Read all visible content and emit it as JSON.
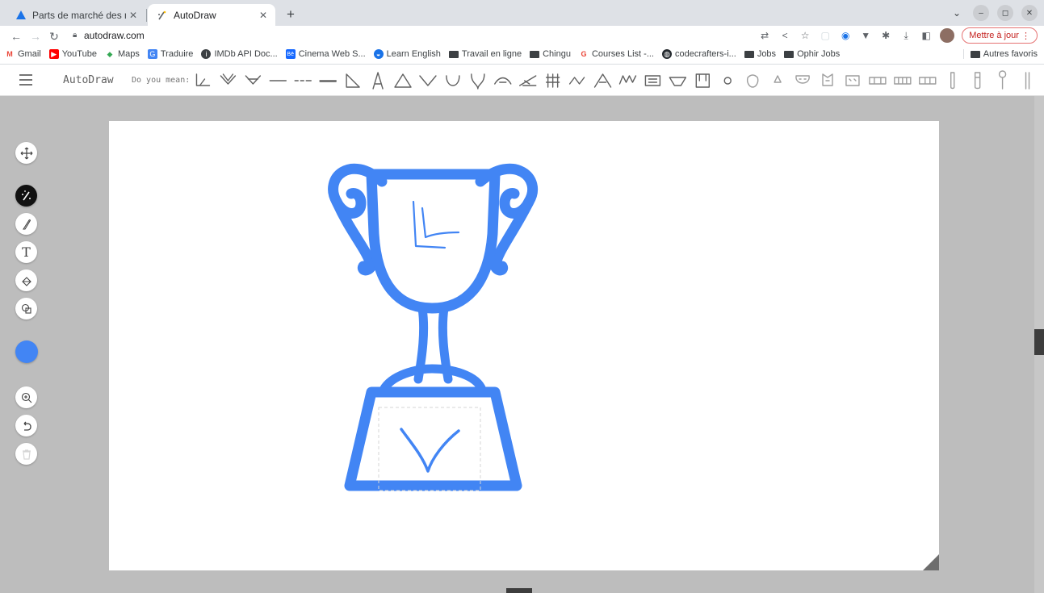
{
  "browser": {
    "tabs": [
      {
        "title": "Parts de marché des navig",
        "active": false,
        "icon": "triangle-favicon"
      },
      {
        "title": "AutoDraw",
        "active": true,
        "icon": "autodraw-favicon"
      }
    ],
    "url": "autodraw.com",
    "update_button": "Mettre à jour",
    "bookmarks": [
      {
        "label": "Gmail",
        "icon": "gmail-icon"
      },
      {
        "label": "YouTube",
        "icon": "youtube-icon"
      },
      {
        "label": "Maps",
        "icon": "maps-icon"
      },
      {
        "label": "Traduire",
        "icon": "translate-icon"
      },
      {
        "label": "IMDb API Doc...",
        "icon": "imdb-icon"
      },
      {
        "label": "Cinema Web S...",
        "icon": "behance-icon"
      },
      {
        "label": "Learn English",
        "icon": "globe-icon"
      },
      {
        "label": "Travail en ligne",
        "icon": "folder-icon"
      },
      {
        "label": "Chingu",
        "icon": "folder-icon"
      },
      {
        "label": "Courses List -...",
        "icon": "google-icon"
      },
      {
        "label": "codecrafters-i...",
        "icon": "github-icon"
      },
      {
        "label": "Jobs",
        "icon": "folder-icon"
      },
      {
        "label": "Ophir Jobs",
        "icon": "folder-icon"
      }
    ],
    "other_bookmarks": "Autres favoris"
  },
  "app": {
    "title": "AutoDraw",
    "do_you_mean": "Do you mean:",
    "suggestion_count": 34,
    "tools": [
      "move-tool",
      "autodraw-tool",
      "draw-tool",
      "type-tool",
      "fill-tool",
      "shape-tool",
      "color-picker",
      "zoom-tool",
      "undo-tool",
      "delete-tool"
    ],
    "active_tool": "autodraw-tool",
    "stroke_color": "#4285f4",
    "canvas_color": "#ffffff",
    "workspace_color": "#bdbdbd"
  }
}
